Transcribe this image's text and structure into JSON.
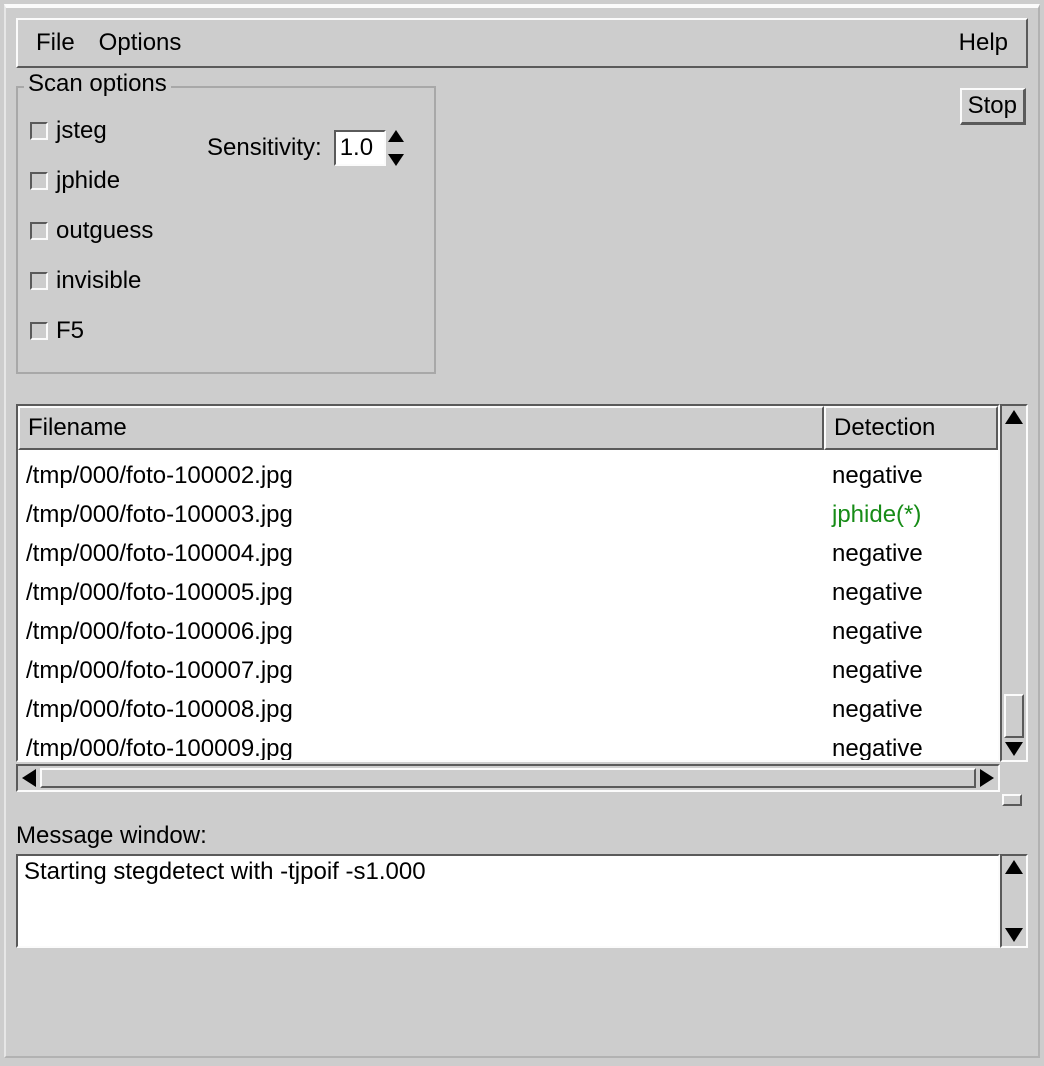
{
  "menubar": {
    "file": "File",
    "options": "Options",
    "help": "Help"
  },
  "scan_options": {
    "legend": "Scan options",
    "checks": [
      {
        "label": "jsteg",
        "checked": false
      },
      {
        "label": "jphide",
        "checked": false
      },
      {
        "label": "outguess",
        "checked": false
      },
      {
        "label": "invisible",
        "checked": false
      },
      {
        "label": "F5",
        "checked": false
      }
    ],
    "sensitivity_label": "Sensitivity:",
    "sensitivity_value": "1.0"
  },
  "stop_button": "Stop",
  "table": {
    "columns": {
      "filename": "Filename",
      "detection": "Detection"
    },
    "rows": [
      {
        "filename": "/tmp/000/foto-100002.jpg",
        "detection": "negative",
        "positive": false
      },
      {
        "filename": "/tmp/000/foto-100003.jpg",
        "detection": "jphide(*)",
        "positive": true
      },
      {
        "filename": "/tmp/000/foto-100004.jpg",
        "detection": "negative",
        "positive": false
      },
      {
        "filename": "/tmp/000/foto-100005.jpg",
        "detection": "negative",
        "positive": false
      },
      {
        "filename": "/tmp/000/foto-100006.jpg",
        "detection": "negative",
        "positive": false
      },
      {
        "filename": "/tmp/000/foto-100007.jpg",
        "detection": "negative",
        "positive": false
      },
      {
        "filename": "/tmp/000/foto-100008.jpg",
        "detection": "negative",
        "positive": false
      },
      {
        "filename": "/tmp/000/foto-100009.jpg",
        "detection": "negative",
        "positive": false
      }
    ]
  },
  "message_window": {
    "label": "Message window:",
    "text": "Starting stegdetect with -tjpoif -s1.000"
  },
  "colors": {
    "bg": "#cdcdcd",
    "positive": "#178c17"
  }
}
